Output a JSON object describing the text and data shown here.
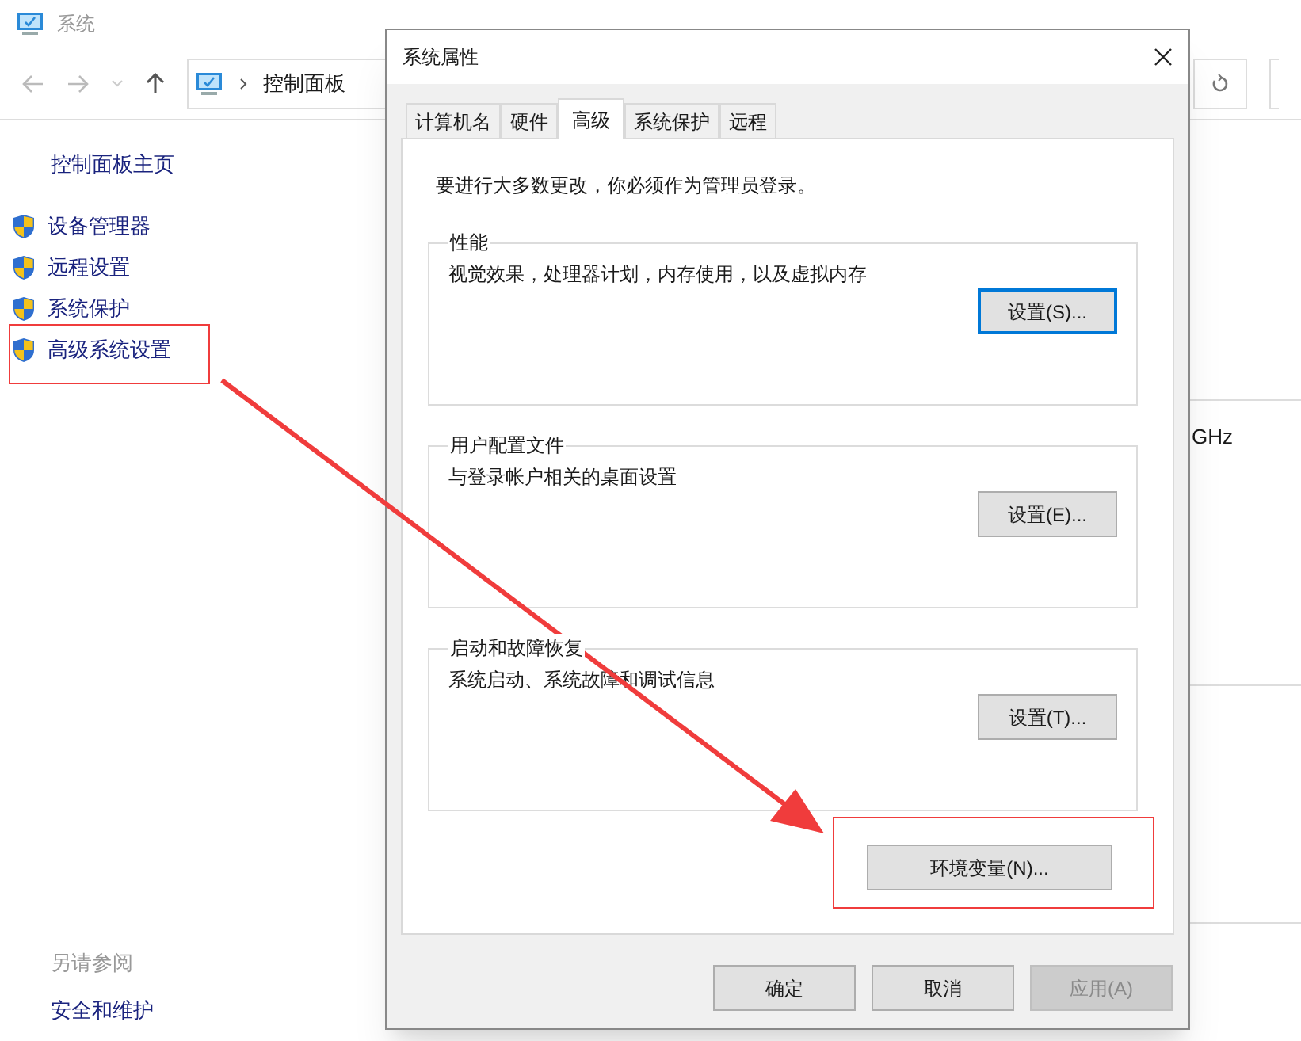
{
  "background_window": {
    "title": "系统",
    "breadcrumb": [
      "控制面板"
    ],
    "sidebar": {
      "home": "控制面板主页",
      "items": [
        {
          "label": "设备管理器"
        },
        {
          "label": "远程设置"
        },
        {
          "label": "系统保护"
        },
        {
          "label": "高级系统设置"
        }
      ],
      "see_also": {
        "heading": "另请参阅",
        "links": [
          "安全和维护"
        ]
      }
    },
    "content_fragments": [
      "GHz"
    ]
  },
  "dialog": {
    "title": "系统属性",
    "tabs": [
      {
        "label": "计算机名",
        "selected": false
      },
      {
        "label": "硬件",
        "selected": false
      },
      {
        "label": "高级",
        "selected": true
      },
      {
        "label": "系统保护",
        "selected": false
      },
      {
        "label": "远程",
        "selected": false
      }
    ],
    "notice": "要进行大多数更改，你必须作为管理员登录。",
    "groups": [
      {
        "title": "性能",
        "description": "视觉效果，处理器计划，内存使用，以及虚拟内存",
        "button": "设置(S)...",
        "focused": true
      },
      {
        "title": "用户配置文件",
        "description": "与登录帐户相关的桌面设置",
        "button": "设置(E)...",
        "focused": false
      },
      {
        "title": "启动和故障恢复",
        "description": "系统启动、系统故障和调试信息",
        "button": "设置(T)...",
        "focused": false
      }
    ],
    "env_button": {
      "label": "环境变量(N)..."
    },
    "buttons": [
      {
        "label": "确定",
        "disabled": false
      },
      {
        "label": "取消",
        "disabled": false
      },
      {
        "label": "应用(A)",
        "disabled": true
      }
    ]
  },
  "annotations": [
    {
      "kind": "highlight-box"
    },
    {
      "kind": "highlight-box"
    },
    {
      "kind": "arrow"
    }
  ]
}
